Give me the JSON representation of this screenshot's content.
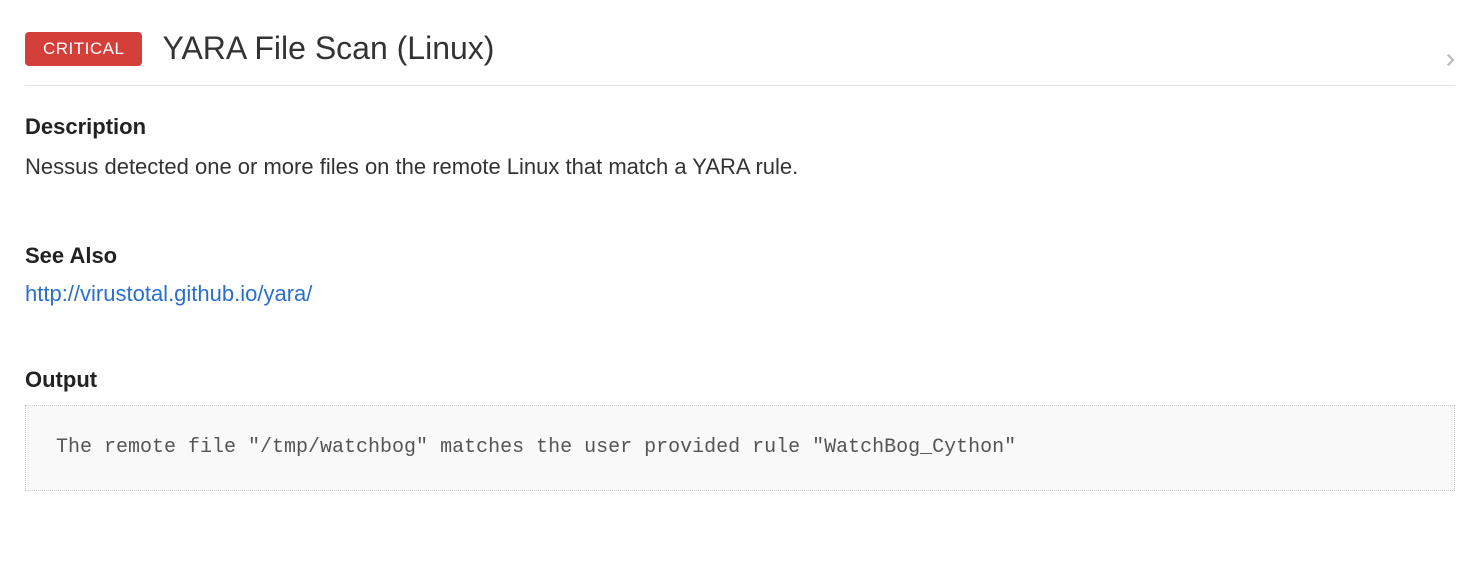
{
  "header": {
    "severity": "CRITICAL",
    "title": "YARA File Scan (Linux)"
  },
  "sections": {
    "description": {
      "heading": "Description",
      "text": "Nessus detected one or more files on the remote Linux that match a YARA rule."
    },
    "seeAlso": {
      "heading": "See Also",
      "link": "http://virustotal.github.io/yara/"
    },
    "output": {
      "heading": "Output",
      "content": "The remote file \"/tmp/watchbog\" matches the user provided rule \"WatchBog_Cython\""
    }
  }
}
